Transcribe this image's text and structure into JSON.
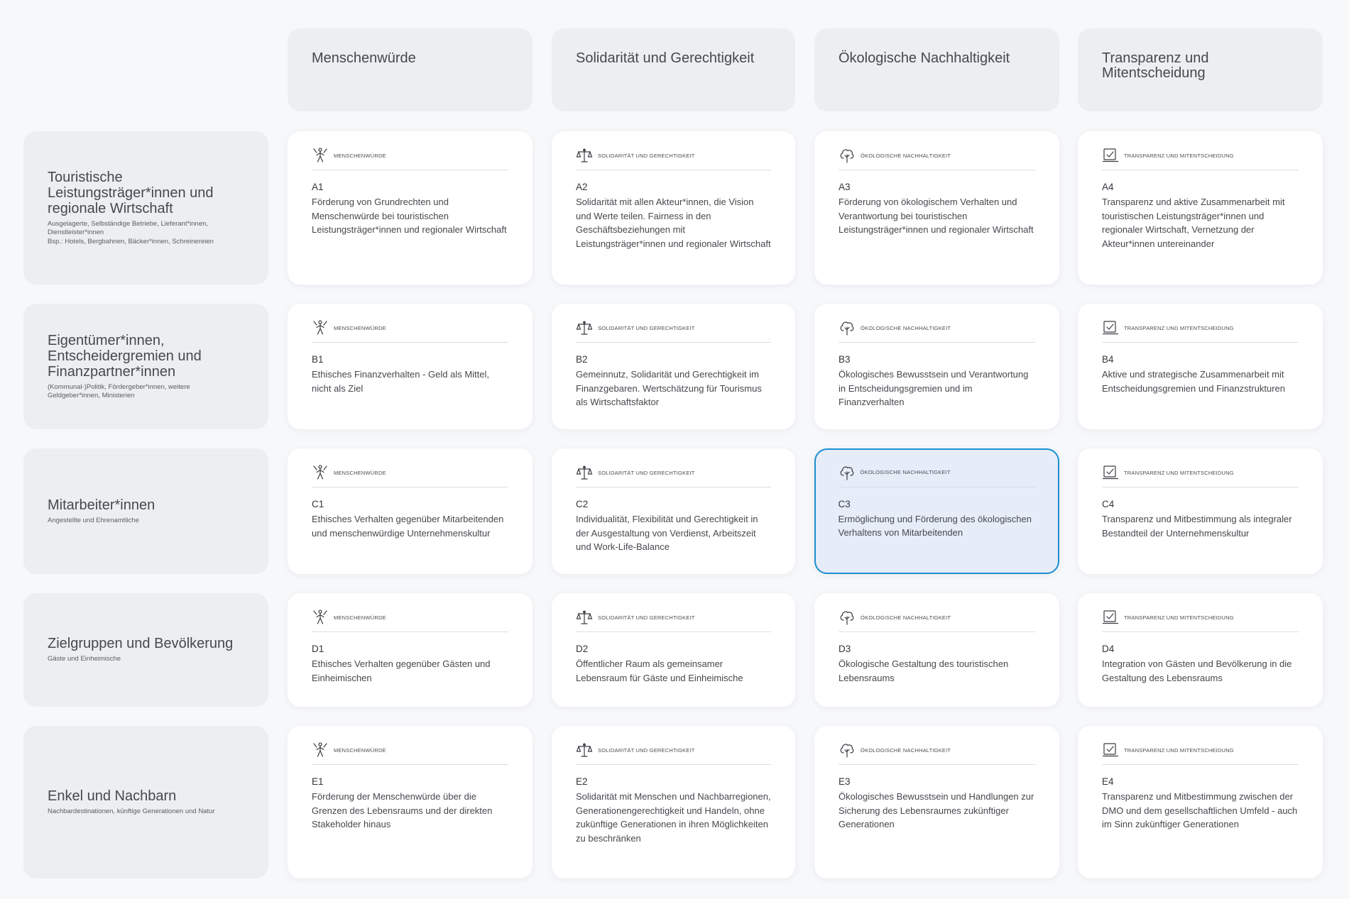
{
  "columns": [
    {
      "title": "Menschenwürde",
      "category": "Menschenwürde",
      "icon": "person-dignity-icon"
    },
    {
      "title": "Solidarität und Gerechtigkeit",
      "category": "Solidarität und Gerechtigkeit",
      "icon": "scales-icon"
    },
    {
      "title": "Ökologische Nachhaltigkeit",
      "category": "Ökologische Nachhaltigkeit",
      "icon": "tree-icon"
    },
    {
      "title": "Transparenz und Mitentscheidung",
      "category": "Transparenz und Mitentscheidung",
      "icon": "checkbox-screen-icon"
    }
  ],
  "rows": [
    {
      "title": "Touristische Leistungsträger*innen und regionale Wirtschaft",
      "subtitle": "Ausgelagerte, Selbständige Betriebe, Lieferant*innen, Dienstleister*innen",
      "subtitle2": "Bsp.: Hotels, Bergbahnen, Bäcker*innen, Schreinereien",
      "cards": [
        {
          "code": "A1",
          "text": "Förderung von Grundrechten und Menschenwürde bei touristischen Leistungsträger*innen und regionaler Wirtschaft"
        },
        {
          "code": "A2",
          "text": "Solidarität mit allen Akteur*innen, die Vision und Werte teilen. Fairness in den Geschäftsbeziehungen mit Leistungsträger*innen und regionaler Wirtschaft"
        },
        {
          "code": "A3",
          "text": "Förderung von ökologischem Verhalten und Verantwortung bei touristischen Leistungsträger*innen und regionaler Wirtschaft"
        },
        {
          "code": "A4",
          "text": "Transparenz und aktive Zusammenarbeit mit touristischen Leistungsträger*innen und regionaler Wirtschaft, Vernetzung der Akteur*innen untereinander"
        }
      ]
    },
    {
      "title": "Eigentümer*innen, Entscheidergremien und Finanzpartner*innen",
      "subtitle": "(Kommunal-)Politik, Fördergeber*innen, weitere Geldgeber*innen, Ministerien",
      "subtitle2": "",
      "cards": [
        {
          "code": "B1",
          "text": "Ethisches Finanzverhalten - Geld als Mittel, nicht als Ziel"
        },
        {
          "code": "B2",
          "text": "Gemeinnutz, Solidarität und Gerechtigkeit im Finanzgebaren. Wertschätzung für Tourismus als Wirtschaftsfaktor"
        },
        {
          "code": "B3",
          "text": "Ökologisches Bewusstsein und Verantwortung in Entscheidungsgremien und im Finanzverhalten"
        },
        {
          "code": "B4",
          "text": "Aktive und strategische Zusammenarbeit mit Entscheidungsgremien und Finanzstrukturen"
        }
      ]
    },
    {
      "title": "Mitarbeiter*innen",
      "subtitle": "Angestellte und Ehrenamtliche",
      "subtitle2": "",
      "cards": [
        {
          "code": "C1",
          "text": "Ethisches Verhalten gegenüber Mitarbeitenden und menschenwürdige Unternehmenskultur"
        },
        {
          "code": "C2",
          "text": "Individualität, Flexibilität und Gerechtigkeit in der Ausgestaltung von Verdienst, Arbeitszeit und Work-Life-Balance"
        },
        {
          "code": "C3",
          "text": "Ermöglichung und Förderung des ökologischen Verhaltens von Mitarbeitenden"
        },
        {
          "code": "C4",
          "text": "Transparenz und Mitbestimmung als integraler Bestandteil der Unternehmenskultur"
        }
      ]
    },
    {
      "title": "Zielgruppen und Bevölkerung",
      "subtitle": "Gäste und Einheimische",
      "subtitle2": "",
      "cards": [
        {
          "code": "D1",
          "text": "Ethisches Verhalten gegenüber Gästen und Einheimischen"
        },
        {
          "code": "D2",
          "text": "Öffentlicher Raum als gemeinsamer Lebensraum für Gäste und Einheimische"
        },
        {
          "code": "D3",
          "text": "Ökologische Gestaltung des touristischen Lebensraums"
        },
        {
          "code": "D4",
          "text": "Integration von Gästen und Bevölkerung in die Gestaltung des Lebensraums"
        }
      ]
    },
    {
      "title": "Enkel und Nachbarn",
      "subtitle": "Nachbardestinationen, künftige Generationen und Natur",
      "subtitle2": "",
      "cards": [
        {
          "code": "E1",
          "text": "Förderung der Menschenwürde über die Grenzen des Lebensraums und der direkten Stakeholder hinaus"
        },
        {
          "code": "E2",
          "text": "Solidarität mit Menschen und Nachbarregionen, Generationengerechtigkeit und Handeln, ohne zukünftige Generationen in ihren Möglichkeiten zu beschränken"
        },
        {
          "code": "E3",
          "text": "Ökologisches Bewusstsein und Handlungen zur Sicherung des Lebensraumes zukünftiger Generationen"
        },
        {
          "code": "E4",
          "text": "Transparenz und Mitbestimmung zwischen der DMO und dem gesellschaftlichen Umfeld - auch im Sinn zukünftiger Generationen"
        }
      ]
    }
  ],
  "selected_card": "C3",
  "colors": {
    "background": "#f7f8fa",
    "header": "#eceef1",
    "card": "#ffffff",
    "selected_fill": "#e6ecf8",
    "selected_border": "#1b8fd0"
  }
}
